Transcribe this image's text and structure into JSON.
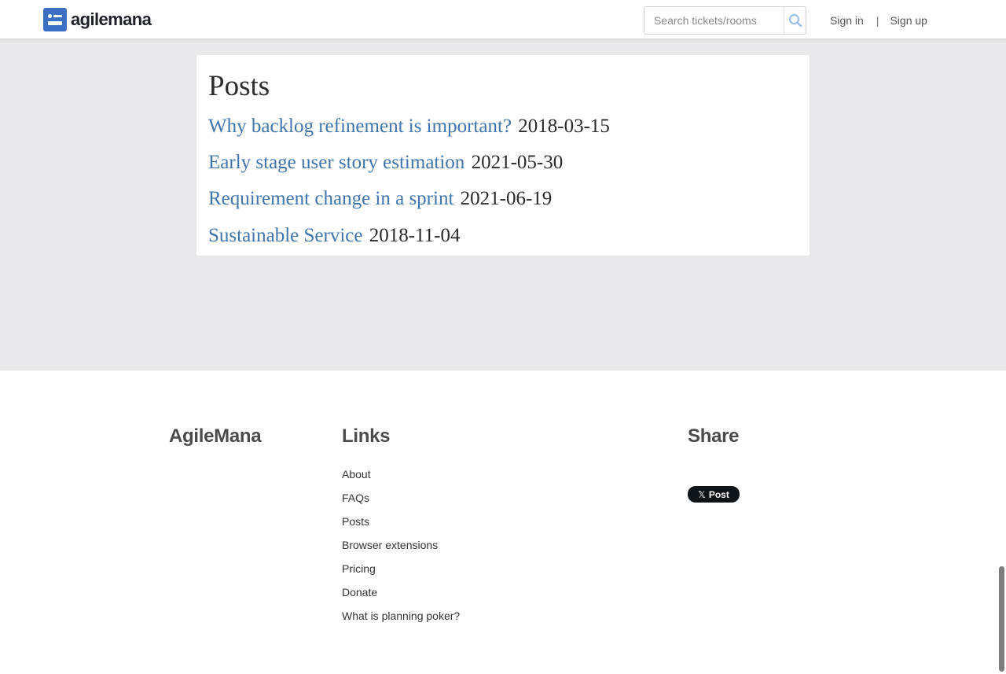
{
  "header": {
    "brand": "agilemana",
    "search_placeholder": "Search tickets/rooms",
    "sign_in": "Sign in",
    "separator": "|",
    "sign_up": "Sign up"
  },
  "posts": {
    "title": "Posts",
    "items": [
      {
        "title": "Why backlog refinement is important?",
        "date": "2018-03-15"
      },
      {
        "title": "Early stage user story estimation",
        "date": "2021-05-30"
      },
      {
        "title": "Requirement change in a sprint",
        "date": "2021-06-19"
      },
      {
        "title": "Sustainable Service",
        "date": "2018-11-04"
      }
    ]
  },
  "footer": {
    "brand_heading": "AgileMana",
    "links_heading": "Links",
    "links": [
      "About",
      "FAQs",
      "Posts",
      "Browser extensions",
      "Pricing",
      "Donate",
      "What is planning poker?"
    ],
    "share_heading": "Share",
    "x_post_label": "Post",
    "x_icon_glyph": "𝕏"
  },
  "colors": {
    "brand_blue": "#3b6fc4",
    "link_blue": "#3f74ad",
    "page_bg": "#e9e9ec",
    "x_button": "#0f1419"
  },
  "icons": {
    "brand": "agilemana-logo-icon",
    "search": "search-icon",
    "x": "x-logo-icon"
  }
}
